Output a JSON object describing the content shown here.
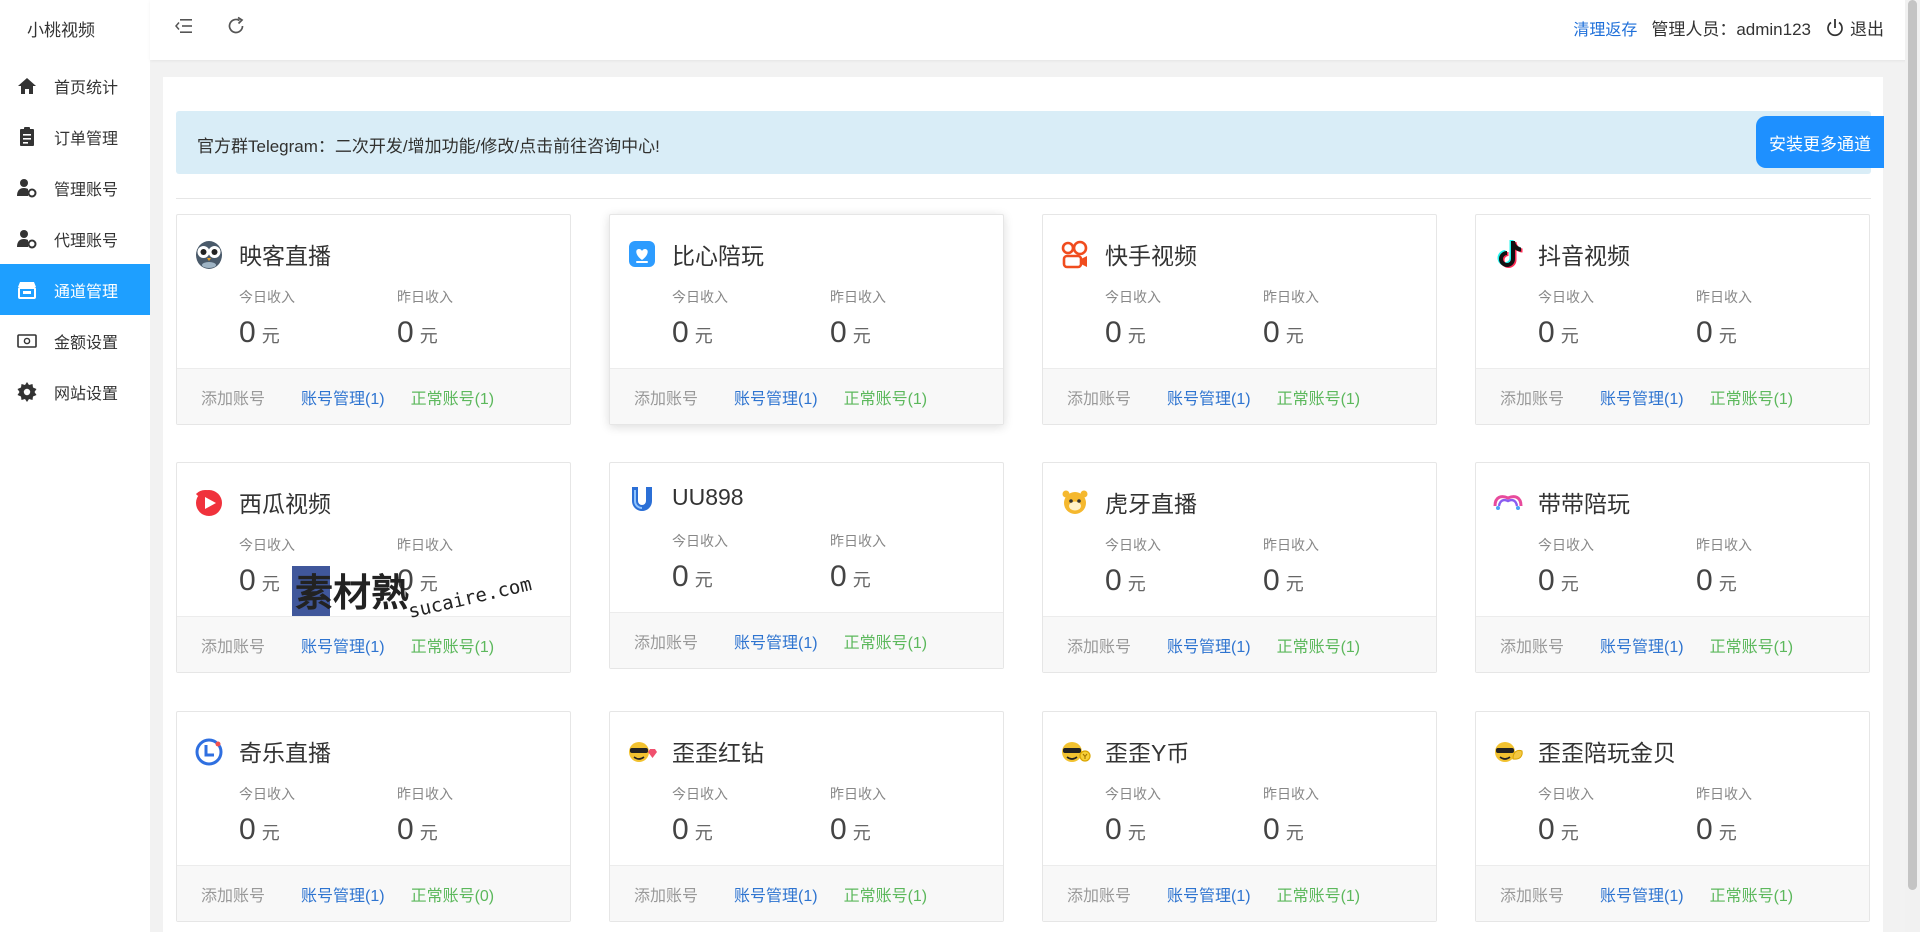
{
  "brand": "小桃视频",
  "sidebar": {
    "items": [
      {
        "label": "首页统计",
        "icon": "home-icon"
      },
      {
        "label": "订单管理",
        "icon": "clipboard-icon"
      },
      {
        "label": "管理账号",
        "icon": "user-gear-icon"
      },
      {
        "label": "代理账号",
        "icon": "user-gear-icon"
      },
      {
        "label": "通道管理",
        "icon": "store-icon",
        "active": true
      },
      {
        "label": "金额设置",
        "icon": "money-icon"
      },
      {
        "label": "网站设置",
        "icon": "gear-icon"
      }
    ]
  },
  "header": {
    "clear_cache": "清理返存",
    "admin": "管理人员：admin123",
    "logout": "退出"
  },
  "notice": {
    "text": "官方群Telegram：二次开发/增加功能/修改/点击前往咨询中心!",
    "button": "安装更多通道"
  },
  "labels": {
    "today": "今日收入",
    "yesterday": "昨日收入",
    "unit": "元",
    "add_account": "添加账号"
  },
  "channels": [
    {
      "name": "映客直播",
      "logo": "owl-logo",
      "today": "0",
      "yesterday": "0",
      "manage": "账号管理(1)",
      "normal": "正常账号(1)"
    },
    {
      "name": "比心陪玩",
      "logo": "bixin-logo",
      "today": "0",
      "yesterday": "0",
      "manage": "账号管理(1)",
      "normal": "正常账号(1)"
    },
    {
      "name": "快手视频",
      "logo": "kuaishou-logo",
      "today": "0",
      "yesterday": "0",
      "manage": "账号管理(1)",
      "normal": "正常账号(1)"
    },
    {
      "name": "抖音视频",
      "logo": "douyin-logo",
      "today": "0",
      "yesterday": "0",
      "manage": "账号管理(1)",
      "normal": "正常账号(1)"
    },
    {
      "name": "西瓜视频",
      "logo": "xigua-logo",
      "today": "0",
      "yesterday": "0",
      "manage": "账号管理(1)",
      "normal": "正常账号(1)"
    },
    {
      "name": "UU898",
      "logo": "uu898-logo",
      "today": "0",
      "yesterday": "0",
      "manage": "账号管理(1)",
      "normal": "正常账号(1)"
    },
    {
      "name": "虎牙直播",
      "logo": "huya-logo",
      "today": "0",
      "yesterday": "0",
      "manage": "账号管理(1)",
      "normal": "正常账号(1)"
    },
    {
      "name": "带带陪玩",
      "logo": "daidai-logo",
      "today": "0",
      "yesterday": "0",
      "manage": "账号管理(1)",
      "normal": "正常账号(1)"
    },
    {
      "name": "奇乐直播",
      "logo": "qile-logo",
      "today": "0",
      "yesterday": "0",
      "manage": "账号管理(1)",
      "normal": "正常账号(0)"
    },
    {
      "name": "歪歪红钻",
      "logo": "yy-red-logo",
      "today": "0",
      "yesterday": "0",
      "manage": "账号管理(1)",
      "normal": "正常账号(1)"
    },
    {
      "name": "歪歪Y币",
      "logo": "yy-coin-logo",
      "today": "0",
      "yesterday": "0",
      "manage": "账号管理(1)",
      "normal": "正常账号(1)"
    },
    {
      "name": "歪歪陪玩金贝",
      "logo": "yy-gold-logo",
      "today": "0",
      "yesterday": "0",
      "manage": "账号管理(1)",
      "normal": "正常账号(1)"
    }
  ],
  "watermark": {
    "text": "素材熟",
    "domain": "sucaire.com"
  }
}
